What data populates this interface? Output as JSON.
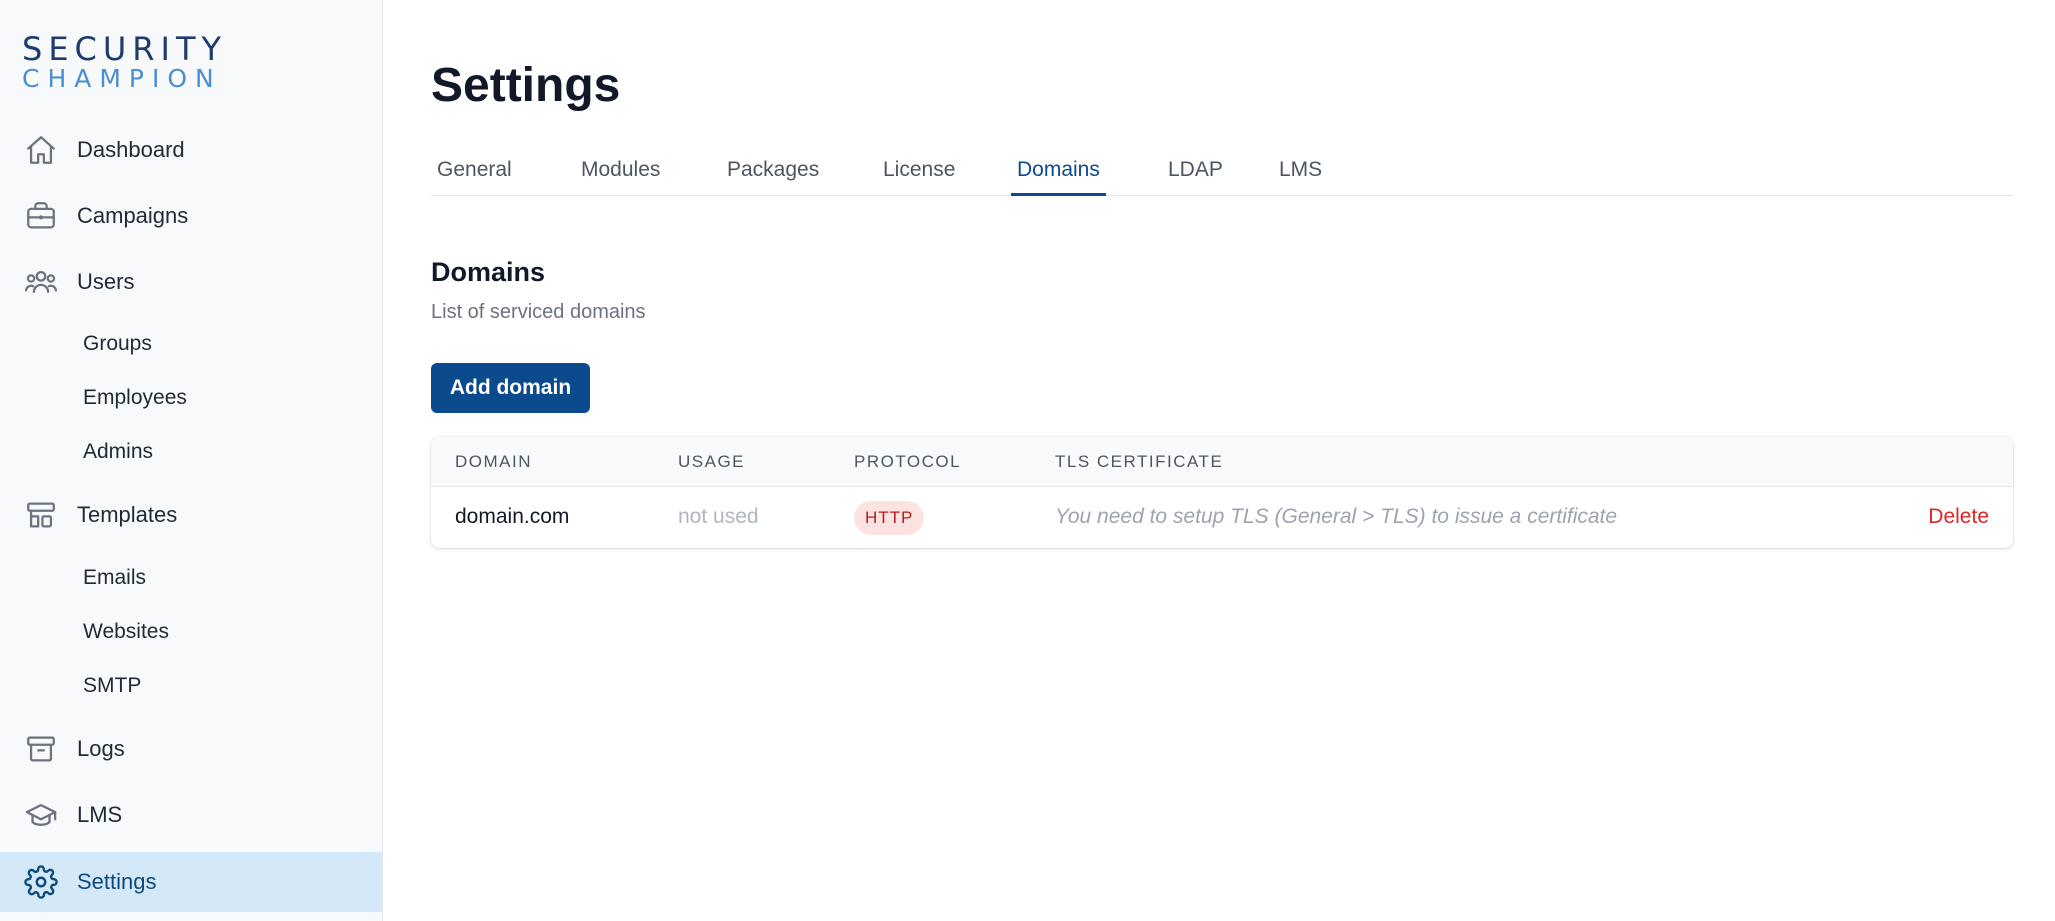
{
  "logo": {
    "line1": "SECURITY",
    "line2": "CHAMPION"
  },
  "sidebar": {
    "items": [
      {
        "label": "Dashboard",
        "icon": "home-icon"
      },
      {
        "label": "Campaigns",
        "icon": "briefcase-icon"
      },
      {
        "label": "Users",
        "icon": "users-icon"
      },
      {
        "label": "Groups"
      },
      {
        "label": "Employees"
      },
      {
        "label": "Admins"
      },
      {
        "label": "Templates",
        "icon": "templates-icon"
      },
      {
        "label": "Emails"
      },
      {
        "label": "Websites"
      },
      {
        "label": "SMTP"
      },
      {
        "label": "Logs",
        "icon": "archive-icon"
      },
      {
        "label": "LMS",
        "icon": "graduation-cap-icon"
      },
      {
        "label": "Settings",
        "icon": "gear-icon",
        "active": true
      }
    ]
  },
  "page": {
    "title": "Settings"
  },
  "tabs": [
    {
      "label": "General"
    },
    {
      "label": "Modules"
    },
    {
      "label": "Packages"
    },
    {
      "label": "License"
    },
    {
      "label": "Domains",
      "active": true
    },
    {
      "label": "LDAP"
    },
    {
      "label": "LMS"
    }
  ],
  "section": {
    "title": "Domains",
    "subtitle": "List of serviced domains",
    "add_button": "Add domain"
  },
  "table": {
    "columns": [
      "DOMAIN",
      "USAGE",
      "PROTOCOL",
      "TLS CERTIFICATE"
    ],
    "rows": [
      {
        "domain": "domain.com",
        "usage": "not used",
        "protocol": "HTTP",
        "tls": "You need to setup TLS (General > TLS) to issue a certificate",
        "action": "Delete"
      }
    ]
  },
  "colors": {
    "accent": "#0b4a8d",
    "active_nav_bg": "#d4e8f8",
    "danger": "#dc2626",
    "badge_bg": "#fde2e2"
  }
}
